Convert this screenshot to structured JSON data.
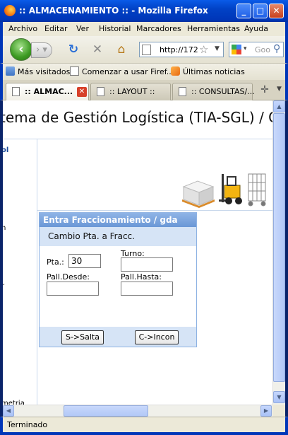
{
  "window": {
    "title": ":: ALMACENAMIENTO :: - Mozilla Firefox"
  },
  "menu": [
    "Archivo",
    "Editar",
    "Ver",
    "Historial",
    "Marcadores",
    "Herramientas",
    "Ayuda"
  ],
  "address": {
    "url": "http://172"
  },
  "search": {
    "placeholder": "Goo"
  },
  "bookmarks": [
    "Más visitados",
    "Comenzar a usar Firef...",
    "Últimas noticias"
  ],
  "tabs": [
    ":: ALMAC...",
    ":: LAYOUT ::",
    ":: CONSULTAS/..."
  ],
  "page": {
    "header": "tema de Gestión Logística (TIA-SGL) / C",
    "left_items": [
      "ol",
      "n",
      "r",
      "metria"
    ]
  },
  "dialog": {
    "title": "Entra Fraccionamiento / gda",
    "subtitle": "Cambio Pta. a Fracc.",
    "pta_label": "Pta.:",
    "pta_value": "30",
    "turno_label": "Turno:",
    "pall_desde_label": "Pall.Desde:",
    "pall_hasta_label": "Pall.Hasta:",
    "btn_salta": "S->Salta",
    "btn_incon": "C->Incon"
  },
  "status": {
    "text": "Terminado"
  }
}
